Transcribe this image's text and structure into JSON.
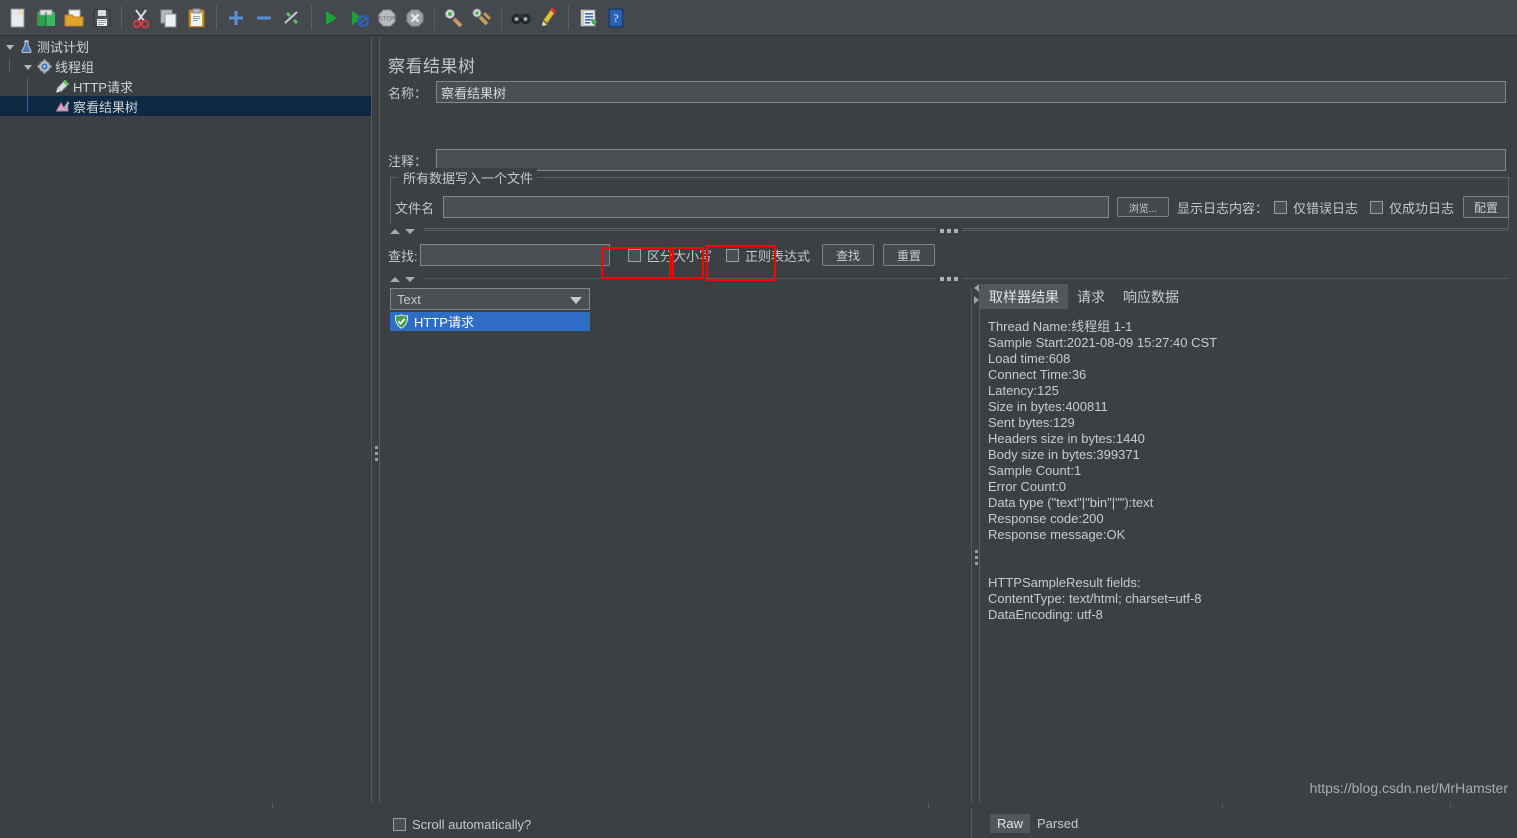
{
  "toolbar": {
    "buttons": [
      {
        "name": "new-icon",
        "tip": "New"
      },
      {
        "name": "templates-icon",
        "tip": "Templates"
      },
      {
        "name": "open-icon",
        "tip": "Open"
      },
      {
        "name": "save-icon",
        "tip": "Save Test Plan"
      },
      {
        "name": "cut-icon",
        "tip": "Cut"
      },
      {
        "name": "copy-icon",
        "tip": "Copy"
      },
      {
        "name": "paste-icon",
        "tip": "Paste"
      },
      {
        "name": "expand-all-icon",
        "tip": "Expand All"
      },
      {
        "name": "collapse-all-icon",
        "tip": "Collapse All"
      },
      {
        "name": "toggle-icon",
        "tip": "Toggle"
      },
      {
        "name": "start-icon",
        "tip": "Start"
      },
      {
        "name": "start-no-timers-icon",
        "tip": "Start no pauses"
      },
      {
        "name": "stop-icon",
        "tip": "Stop"
      },
      {
        "name": "shutdown-icon",
        "tip": "Shutdown"
      },
      {
        "name": "clear-icon",
        "tip": "Clear"
      },
      {
        "name": "clear-all-icon",
        "tip": "Clear All"
      },
      {
        "name": "search-icon",
        "tip": "Search"
      },
      {
        "name": "reset-search-icon",
        "tip": "Reset Search"
      },
      {
        "name": "function-helper-icon",
        "tip": "Function Helper Dialog"
      },
      {
        "name": "help-icon",
        "tip": "Help"
      }
    ]
  },
  "tree": {
    "items": [
      {
        "label": "测试计划",
        "icon": "test-plan-icon",
        "depth": 0,
        "expanded": true,
        "selected": false
      },
      {
        "label": "线程组",
        "icon": "thread-group-icon",
        "depth": 1,
        "expanded": true,
        "selected": false
      },
      {
        "label": "HTTP请求",
        "icon": "http-request-icon",
        "depth": 2,
        "expanded": false,
        "selected": false
      },
      {
        "label": "察看结果树",
        "icon": "view-results-tree-icon",
        "depth": 2,
        "expanded": false,
        "selected": true
      }
    ]
  },
  "panel": {
    "title": "察看结果树",
    "name_label": "名称：",
    "name_value": "察看结果树",
    "comment_label": "注释：",
    "comment_value": "",
    "group_legend": "所有数据写入一个文件",
    "filename_label": "文件名",
    "filename_value": "",
    "filename_placeholder": "",
    "browse_label": "浏览...",
    "log_display_label": "显示日志内容：",
    "errors_only_label": "仅错误日志",
    "errors_only_checked": false,
    "successes_only_label": "仅成功日志",
    "successes_only_checked": false,
    "configure_label": "配置"
  },
  "search": {
    "label": "查找:",
    "value": "",
    "case_sensitive_label": "区分大小写",
    "case_sensitive_checked": false,
    "regex_label": "正则表达式",
    "regex_checked": false,
    "find_label": "查找",
    "reset_label": "重置"
  },
  "renderer": {
    "selected": "Text"
  },
  "results": {
    "items": [
      {
        "label": "HTTP请求",
        "status": "success",
        "selected": true
      }
    ],
    "scroll_auto_label": "Scroll automatically?",
    "scroll_auto_checked": false
  },
  "tabs": [
    {
      "label": "取样器结果",
      "active": true,
      "annotated": true
    },
    {
      "label": "请求",
      "active": false,
      "annotated": true
    },
    {
      "label": "响应数据",
      "active": false,
      "annotated": true
    }
  ],
  "sampler_result": {
    "text": "Thread Name:线程组 1-1\nSample Start:2021-08-09 15:27:40 CST\nLoad time:608\nConnect Time:36\nLatency:125\nSize in bytes:400811\nSent bytes:129\nHeaders size in bytes:1440\nBody size in bytes:399371\nSample Count:1\nError Count:0\nData type (\"text\"|\"bin\"|\"\"):text\nResponse code:200\nResponse message:OK\n\n\nHTTPSampleResult fields:\nContentType: text/html; charset=utf-8\nDataEncoding: utf-8",
    "fields": [
      {
        "key": "Thread Name",
        "value": "线程组 1-1"
      },
      {
        "key": "Sample Start",
        "value": "2021-08-09 15:27:40 CST"
      },
      {
        "key": "Load time",
        "value": "608"
      },
      {
        "key": "Connect Time",
        "value": "36"
      },
      {
        "key": "Latency",
        "value": "125"
      },
      {
        "key": "Size in bytes",
        "value": "400811"
      },
      {
        "key": "Sent bytes",
        "value": "129"
      },
      {
        "key": "Headers size in bytes",
        "value": "1440"
      },
      {
        "key": "Body size in bytes",
        "value": "399371"
      },
      {
        "key": "Sample Count",
        "value": "1"
      },
      {
        "key": "Error Count",
        "value": "0"
      },
      {
        "key": "Data type (\"text\"|\"bin\"|\"\")",
        "value": "text"
      },
      {
        "key": "Response code",
        "value": "200"
      },
      {
        "key": "Response message",
        "value": "OK"
      },
      {
        "key": "ContentType",
        "value": "text/html; charset=utf-8"
      },
      {
        "key": "DataEncoding",
        "value": "utf-8"
      }
    ]
  },
  "bottom": {
    "raw_label": "Raw",
    "parsed_label": "Parsed",
    "raw_active": true
  },
  "watermark": "https://blog.csdn.net/MrHamster",
  "colors": {
    "window_bg": "#3c4043",
    "toolbar_bg": "#45494d",
    "field_bg": "#4a4f53",
    "selection_blue": "#2f6cc4",
    "tree_selection": "#0d2944",
    "annotation_red": "#fe0000",
    "text": "#c8cacb"
  }
}
